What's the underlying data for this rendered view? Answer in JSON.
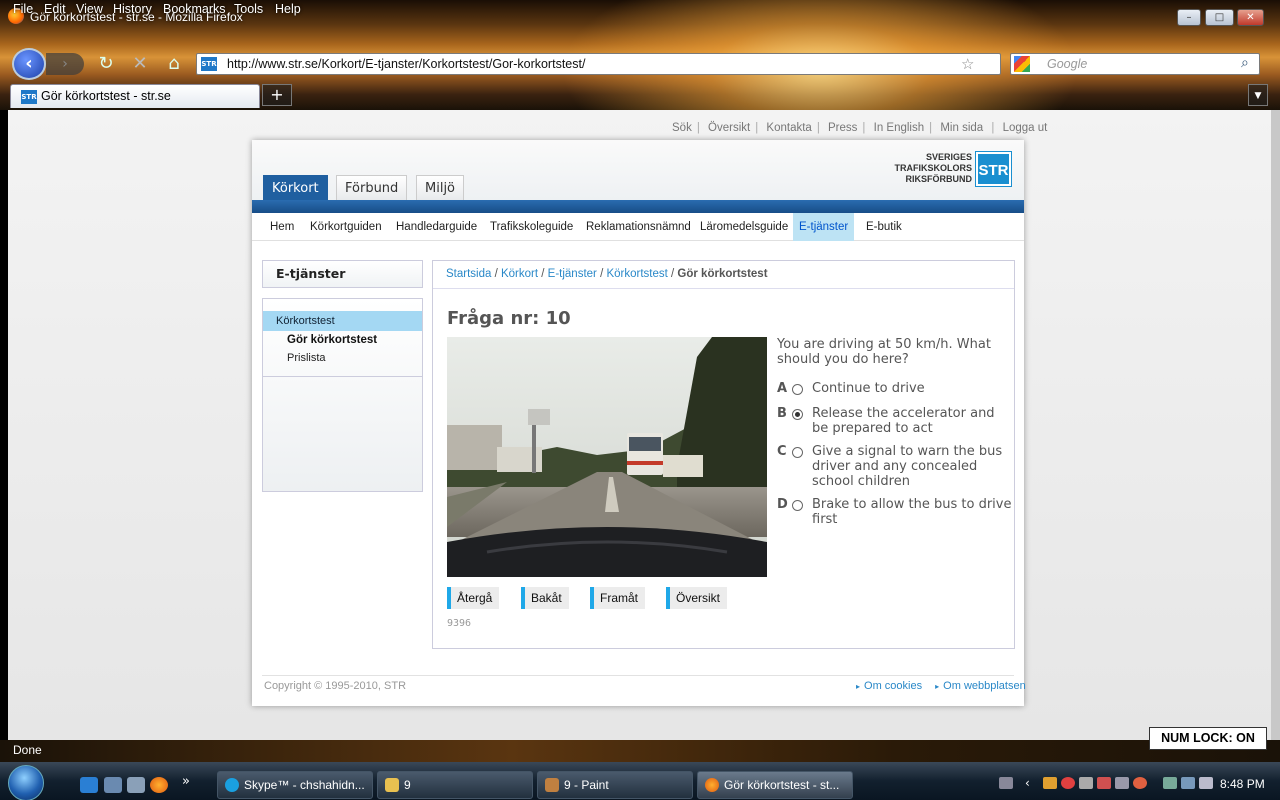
{
  "window": {
    "title": "Gör körkortstest - str.se - Mozilla Firefox",
    "controls": {
      "minimize": "–",
      "maximize": "□",
      "close": "✕"
    }
  },
  "menubar": [
    "File",
    "Edit",
    "View",
    "History",
    "Bookmarks",
    "Tools",
    "Help"
  ],
  "toolbar": {
    "url": "http://www.str.se/Korkort/E-tjanster/Korkortstest/Gor-korkortstest/",
    "favicon_text": "STR",
    "search_placeholder": "Google"
  },
  "tabs": [
    {
      "label": "Gör körkortstest - str.se"
    }
  ],
  "site": {
    "util_nav": [
      "Sök",
      "Översikt",
      "Kontakta",
      "Press",
      "In English",
      "Min sida",
      "Logga ut"
    ],
    "main_tabs": [
      "Körkort",
      "Förbund",
      "Miljö"
    ],
    "logo": {
      "line1": "SVERIGES",
      "line2": "TRAFIKSKOLORS",
      "line3": "RIKSFÖRBUND",
      "badge": "STR"
    },
    "sub_nav": [
      "Hem",
      "Körkortguiden",
      "Handledarguide",
      "Trafikskoleguide",
      "Reklamationsnämnd",
      "Läromedelsguide",
      "E-tjänster",
      "E-butik"
    ],
    "sub_nav_active": "E-tjänster",
    "sidebar": {
      "heading": "E-tjänster",
      "active_item": "Körkortstest",
      "sub_items": [
        "Gör körkortstest",
        "Prislista"
      ]
    },
    "breadcrumb": {
      "links": [
        "Startsida",
        "Körkort",
        "E-tjänster",
        "Körkortstest"
      ],
      "current": "Gör körkortstest"
    },
    "question": {
      "title": "Fråga nr: 10",
      "text": "You are driving at 50 km/h. What should you do here?",
      "options": [
        {
          "letter": "A",
          "text": "Continue to drive",
          "selected": false
        },
        {
          "letter": "B",
          "text": "Release the accelerator and be prepared to act",
          "selected": true
        },
        {
          "letter": "C",
          "text": "Give a signal to warn the bus driver and any concealed school children",
          "selected": false
        },
        {
          "letter": "D",
          "text": "Brake to allow the bus to drive first",
          "selected": false
        }
      ],
      "nav_buttons": [
        "Återgå",
        "Bakåt",
        "Framåt",
        "Översikt"
      ],
      "id": "9396"
    },
    "footer": {
      "copyright": "Copyright © 1995-2010, STR",
      "links": [
        "Om cookies",
        "Om webbplatsen"
      ]
    }
  },
  "statusbar": {
    "text": "Done",
    "numlock": "NUM LOCK: ON"
  },
  "taskbar": {
    "tasks": [
      {
        "label": "Skype™ - chshahidn...",
        "active": false
      },
      {
        "label": "9",
        "active": false
      },
      {
        "label": "9 - Paint",
        "active": false
      },
      {
        "label": "Gör körkortstest - st...",
        "active": true
      }
    ],
    "clock": "8:48 PM",
    "overflow": "»"
  },
  "colors": {
    "brand_blue": "#1f5fa0",
    "accent_cyan": "#1fa8e8",
    "link": "#2a88c8"
  }
}
